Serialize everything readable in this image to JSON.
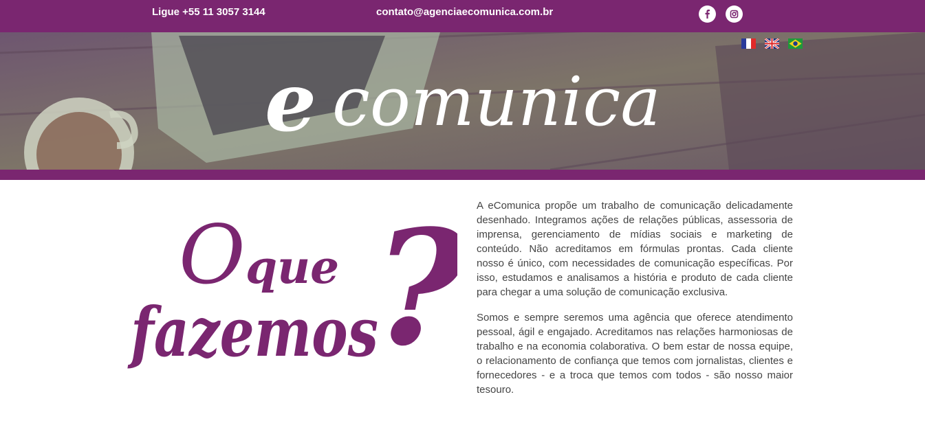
{
  "topbar": {
    "phone": "Ligue +55 11 3057 3144",
    "email": "contato@agenciaecomunica.com.br",
    "social": [
      {
        "name": "facebook-icon",
        "glyph": "f"
      },
      {
        "name": "instagram-icon",
        "glyph": "◙"
      }
    ]
  },
  "languages": [
    {
      "name": "french-flag-icon",
      "lang": "FR"
    },
    {
      "name": "english-flag-icon",
      "lang": "EN"
    },
    {
      "name": "brazil-flag-icon",
      "lang": "PT"
    }
  ],
  "logo": {
    "e": "e",
    "rest": "comunica"
  },
  "headline": {
    "line1": "O",
    "line1b": "que",
    "line2": "fazemos",
    "mark": "?"
  },
  "content": {
    "paragraph1": "A eComunica propõe um trabalho de comunicação delicadamente desenhado. Integramos ações de relações públicas, assessoria de imprensa, gerenciamento de mídias sociais e marketing de conteúdo. Não acreditamos em fórmulas prontas. Cada cliente nosso é único, com necessidades de comunicação específicas. Por isso, estudamos e analisamos a história e produto de cada cliente para chegar a uma solução de comunicação exclusiva.",
    "paragraph2": "Somos e sempre seremos uma agência que oferece atendimento pessoal, ágil e engajado. Acreditamos nas relações harmoniosas de trabalho e na economia colaborativa. O bem estar de nossa equipe, o relacionamento de confiança que temos com jornalistas, clientes e fornecedores - e a troca que temos com todos - são nosso maior tesouro."
  },
  "colors": {
    "brand_purple": "#7a2670",
    "text_gray": "#444444"
  }
}
